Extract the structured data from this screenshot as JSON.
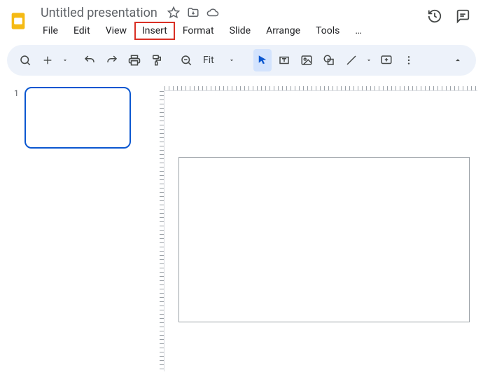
{
  "header": {
    "title": "Untitled presentation"
  },
  "menu": {
    "items": [
      "File",
      "Edit",
      "View",
      "Insert",
      "Format",
      "Slide",
      "Arrange",
      "Tools"
    ],
    "overflow": "…",
    "highlighted_index": 3
  },
  "toolbar": {
    "zoom_label": "Fit"
  },
  "filmstrip": {
    "slides": [
      {
        "number": "1"
      }
    ]
  }
}
